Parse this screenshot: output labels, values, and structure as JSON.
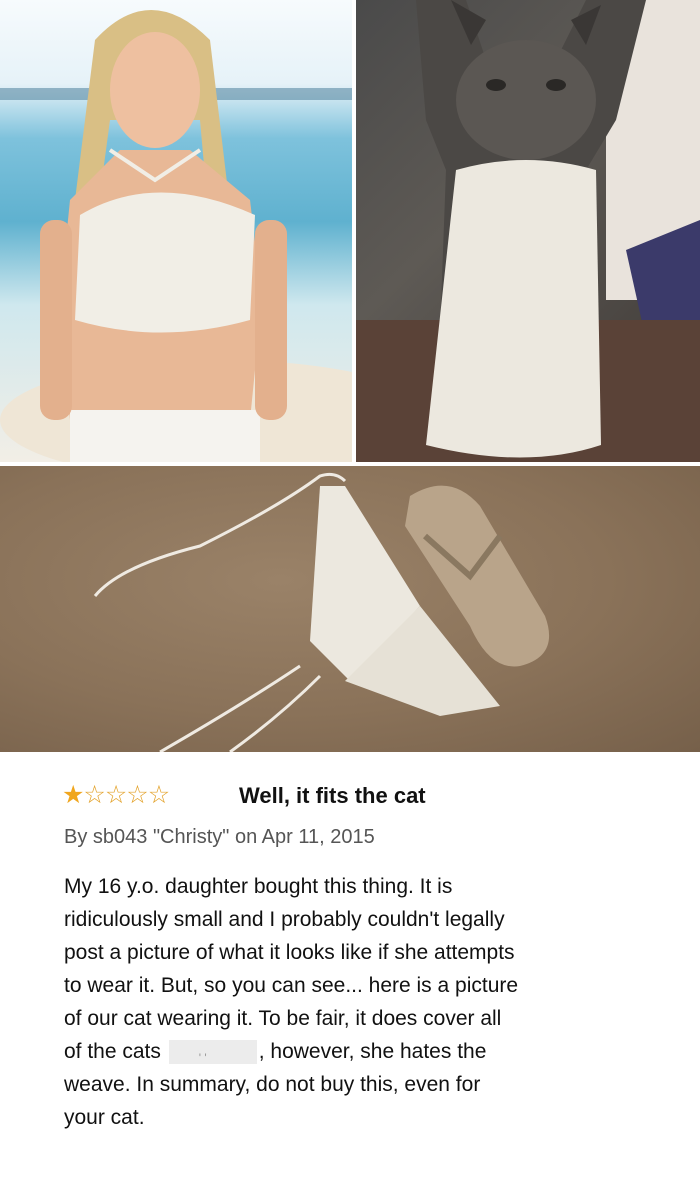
{
  "photos": {
    "woman_photo": "woman-wearing-crochet-top-photo",
    "cat_photo": "cat-wearing-crochet-top-photo",
    "beach_photo": "crochet-top-and-flip-flop-on-sand-photo"
  },
  "review": {
    "rating": 1,
    "rating_max": 5,
    "star_icons": [
      "star-filled-icon",
      "star-empty-icon",
      "star-empty-icon",
      "star-empty-icon",
      "star-empty-icon"
    ],
    "title": "Well, it fits the cat",
    "byline": {
      "prefix": "By",
      "author": "sb043 \"Christy\"",
      "on": "on",
      "date": "Apr 11, 2015"
    },
    "body_lines": [
      "My 16 y.o. daughter bought this thing. It is",
      "ridiculously small and I probably couldn't legally",
      "post a picture of what it looks like if she attempts",
      "to wear it. But, so you can see... here is a picture",
      "of our cat wearing it. To be fair, it does cover all"
    ],
    "body_line6_before": "of the cats",
    "body_line6_after": ", however, she hates the",
    "body_lines_end": [
      "weave. In summary, do not buy this, even for",
      "your cat."
    ]
  },
  "colors": {
    "star": "#f0a61e",
    "title": "#111111",
    "byline": "#555555"
  }
}
